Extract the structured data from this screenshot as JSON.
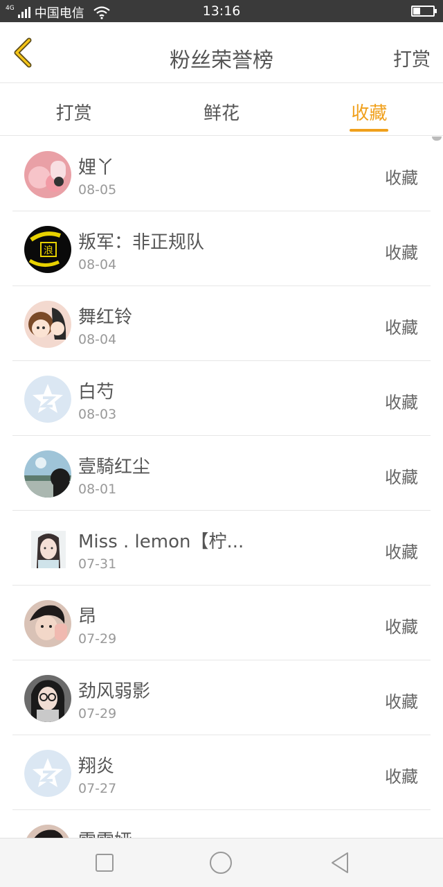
{
  "status_bar": {
    "network": "4G",
    "carrier": "中国电信",
    "time": "13:16",
    "battery_level": 0.35
  },
  "header": {
    "title": "粉丝荣誉榜",
    "right_action": "打赏"
  },
  "tabs": [
    {
      "label": "打赏",
      "active": false
    },
    {
      "label": "鲜花",
      "active": false
    },
    {
      "label": "收藏",
      "active": true
    }
  ],
  "colors": {
    "accent": "#f0a01c",
    "text": "#555555",
    "secondary_text": "#999999",
    "divider": "#e6e6e6"
  },
  "fans": [
    {
      "name": "娌丫",
      "date": "08-05",
      "action": "收藏",
      "avatar": "pink-photo-avatar"
    },
    {
      "name": "叛军：非正规队",
      "date": "08-04",
      "action": "收藏",
      "avatar": "dark-yellow-avatar"
    },
    {
      "name": "舞红铃",
      "date": "08-04",
      "action": "收藏",
      "avatar": "anime-girls-avatar"
    },
    {
      "name": "白芍",
      "date": "08-03",
      "action": "收藏",
      "avatar": "default-star-avatar"
    },
    {
      "name": "壹騎红尘",
      "date": "08-01",
      "action": "收藏",
      "avatar": "landscape-avatar"
    },
    {
      "name": "Miss . lemon【柠...",
      "date": "07-31",
      "action": "收藏",
      "avatar": "girl-photo-avatar"
    },
    {
      "name": "昂",
      "date": "07-29",
      "action": "收藏",
      "avatar": "person-photo-avatar"
    },
    {
      "name": "劲风弱影",
      "date": "07-29",
      "action": "收藏",
      "avatar": "glasses-girl-avatar"
    },
    {
      "name": "翔炎",
      "date": "07-27",
      "action": "收藏",
      "avatar": "default-star-avatar"
    },
    {
      "name": "雷雷娅",
      "date": "",
      "action": "",
      "avatar": "person-photo-avatar"
    }
  ]
}
